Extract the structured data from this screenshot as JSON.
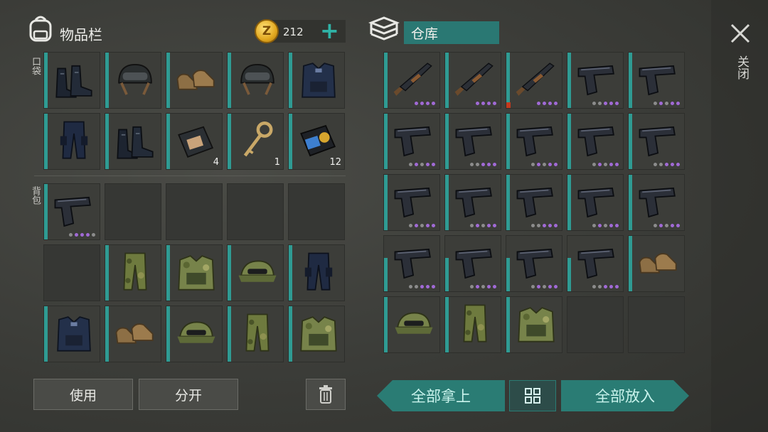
{
  "inventory": {
    "title": "物品栏",
    "coins": "212",
    "add_symbol": "+",
    "pocket_label": "口袋",
    "backpack_label": "背包",
    "pocket_items": [
      {
        "icon": "combat-boots-icon",
        "qty": ""
      },
      {
        "icon": "tactical-helmet-icon",
        "qty": ""
      },
      {
        "icon": "tan-boots-icon",
        "qty": ""
      },
      {
        "icon": "tactical-helmet-icon",
        "qty": ""
      },
      {
        "icon": "police-vest-icon",
        "qty": ""
      },
      {
        "icon": "police-pants-icon",
        "qty": ""
      },
      {
        "icon": "combat-boots-icon",
        "qty": ""
      },
      {
        "icon": "id-wallet-icon",
        "qty": "4"
      },
      {
        "icon": "key-icon",
        "qty": "1"
      },
      {
        "icon": "police-badge-icon",
        "qty": "12"
      }
    ],
    "backpack_items": [
      {
        "icon": "pistol-icon",
        "qty": ""
      },
      {
        "icon": "empty",
        "qty": ""
      },
      {
        "icon": "empty",
        "qty": ""
      },
      {
        "icon": "empty",
        "qty": ""
      },
      {
        "icon": "empty",
        "qty": ""
      },
      {
        "icon": "empty",
        "qty": ""
      },
      {
        "icon": "camo-pants-icon",
        "qty": ""
      },
      {
        "icon": "camo-vest-icon",
        "qty": ""
      },
      {
        "icon": "camo-cap-icon",
        "qty": ""
      },
      {
        "icon": "police-pants-icon",
        "qty": ""
      },
      {
        "icon": "police-vest-icon",
        "qty": ""
      },
      {
        "icon": "tan-boots-icon",
        "qty": ""
      },
      {
        "icon": "camo-cap-icon",
        "qty": ""
      },
      {
        "icon": "camo-pants-icon",
        "qty": ""
      },
      {
        "icon": "camo-vest-icon",
        "qty": ""
      }
    ],
    "use_button": "使用",
    "split_button": "分开"
  },
  "warehouse": {
    "title": "仓库",
    "items": [
      "shotgun-icon",
      "shotgun-icon",
      "shotgun-icon",
      "pistol-icon",
      "pistol-icon",
      "pistol-icon",
      "pistol-icon",
      "pistol-icon",
      "pistol-icon",
      "pistol-icon",
      "pistol-icon",
      "pistol-icon",
      "pistol-icon",
      "pistol-icon",
      "pistol-icon",
      "pistol-icon",
      "pistol-icon",
      "pistol-icon",
      "pistol-icon",
      "tan-boots-icon",
      "camo-cap-icon",
      "camo-pants-icon",
      "camo-vest-icon",
      "empty",
      "empty"
    ],
    "take_all_button": "全部拿上",
    "put_all_button": "全部放入"
  },
  "close_label": "关闭",
  "colors": {
    "accent": "#2a7c74",
    "bar": "#2f9b93",
    "dot_purple": "#a16ad6",
    "dot_gray": "#8c8c8c"
  }
}
